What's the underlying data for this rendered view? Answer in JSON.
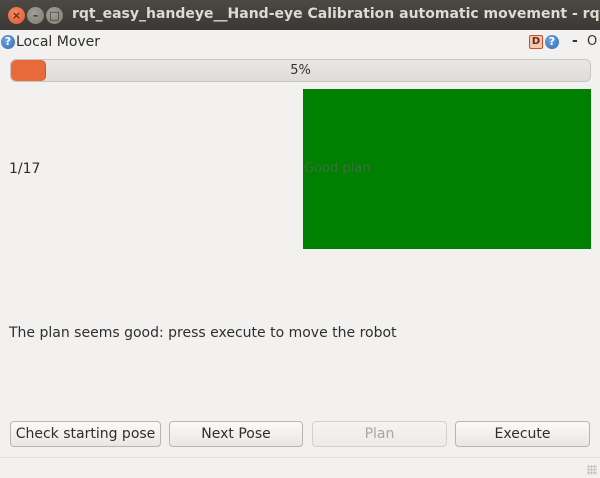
{
  "window": {
    "title": "rqt_easy_handeye__Hand-eye Calibration automatic movement - rqt",
    "controls": {
      "close": "×",
      "minimize": "–",
      "maximize": "□"
    }
  },
  "plugin": {
    "title": "Local Mover",
    "help_icon_glyph": "?",
    "d_badge": "D",
    "help_right_glyph": "?",
    "minimize_glyph": "-",
    "float_glyph": "O"
  },
  "progress": {
    "value_fraction": 0.05,
    "label": "5%",
    "fill_color": "#e8693a"
  },
  "counter": "1/17",
  "status": {
    "text": "Good plan",
    "color": "#008000",
    "text_color": "#3b6e3b"
  },
  "message": "The plan seems good: press execute to move the robot",
  "buttons": {
    "check_starting_pose": "Check starting pose",
    "next_pose": "Next Pose",
    "plan": "Plan",
    "execute": "Execute"
  }
}
